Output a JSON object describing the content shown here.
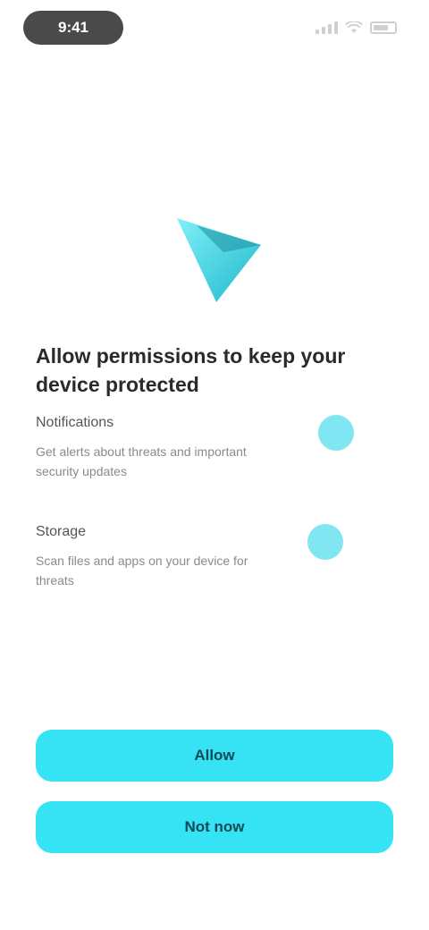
{
  "status_bar": {
    "time": "9:41"
  },
  "logo": {
    "icon": "triangle-logo-icon",
    "color": "#3dd8ea"
  },
  "content": {
    "heading": "Allow permissions to keep your device protected",
    "permissions": [
      {
        "title": "Notifications",
        "description": "Get alerts about threats and important security updates"
      },
      {
        "title": "Storage",
        "description": "Scan files and apps on your device for threats"
      }
    ]
  },
  "actions": {
    "primary_label": "Allow",
    "secondary_label": "Not now"
  },
  "colors": {
    "accent": "#36e3f4",
    "toggle": "#7fe6f2"
  }
}
